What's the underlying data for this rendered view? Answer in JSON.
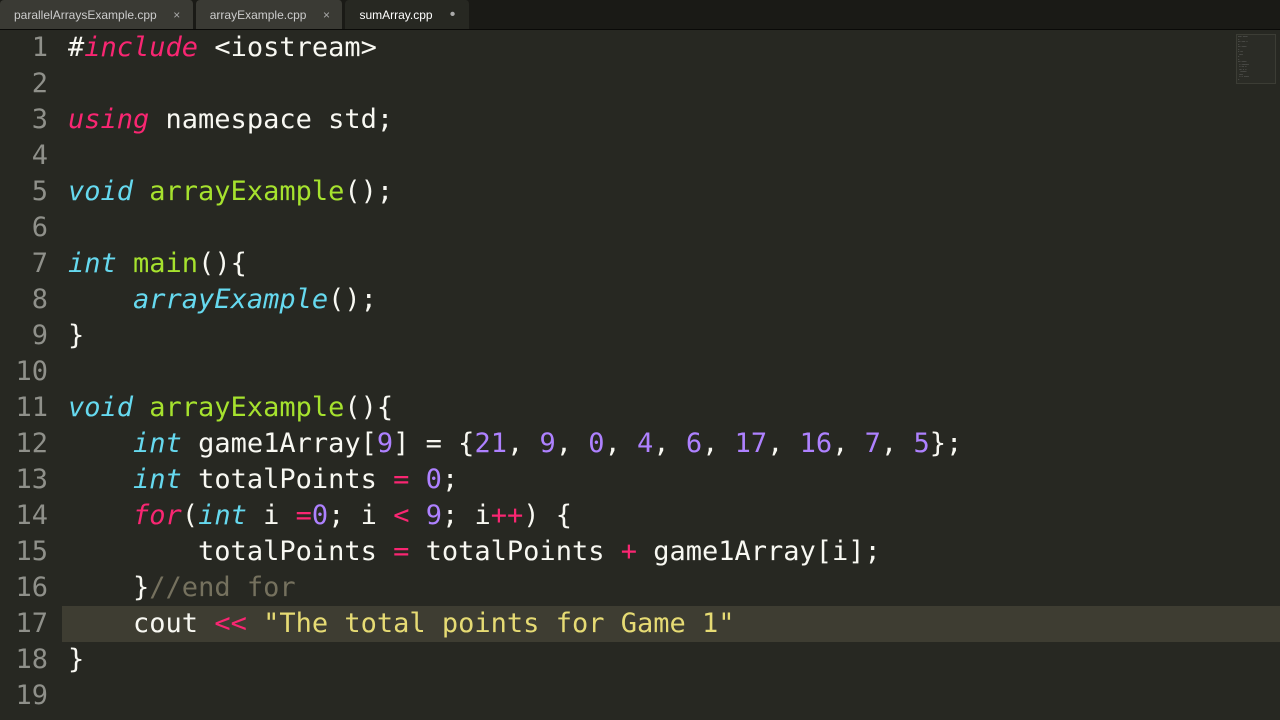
{
  "tabs": [
    {
      "label": "parallelArraysExample.cpp",
      "modified": false
    },
    {
      "label": "arrayExample.cpp",
      "modified": false
    },
    {
      "label": "sumArray.cpp",
      "modified": true
    }
  ],
  "active_tab": 2,
  "line_numbers": [
    "1",
    "2",
    "3",
    "4",
    "5",
    "6",
    "7",
    "8",
    "9",
    "10",
    "11",
    "12",
    "13",
    "14",
    "15",
    "16",
    "17",
    "18",
    "19"
  ],
  "highlighted_line": 17,
  "code": {
    "l1": {
      "hash": "#",
      "include": "include",
      "rest": " <iostream>"
    },
    "l3": {
      "using": "using",
      "ns": " namespace",
      "std": " std",
      "semi": ";"
    },
    "l5": {
      "void": "void ",
      "fn": "arrayExample",
      "rest": "();"
    },
    "l7": {
      "int": "int ",
      "fn": "main",
      "rest": "(){"
    },
    "l8": {
      "indent": "    ",
      "fn": "arrayExample",
      "rest": "();"
    },
    "l9": {
      "brace": "}"
    },
    "l11": {
      "void": "void ",
      "fn": "arrayExample",
      "rest": "(){"
    },
    "l12": {
      "indent": "    ",
      "int": "int",
      "name": " game1Array[",
      "size": "9",
      "mid": "] = {",
      "v0": "21",
      "c0": ", ",
      "v1": "9",
      "c1": ", ",
      "v2": "0",
      "c2": ", ",
      "v3": "4",
      "c3": ", ",
      "v4": "6",
      "c4": ", ",
      "v5": "17",
      "c5": ", ",
      "v6": "16",
      "c6": ", ",
      "v7": "7",
      "c7": ", ",
      "v8": "5",
      "end": "};"
    },
    "l13": {
      "indent": "    ",
      "int": "int",
      "name": " totalPoints ",
      "eq": "=",
      "sp": " ",
      "zero": "0",
      "semi": ";"
    },
    "l14": {
      "indent": "    ",
      "for": "for",
      "p1": "(",
      "int": "int",
      "rest1": " i ",
      "eq": "=",
      "zero": "0",
      "semi1": "; i ",
      "lt": "<",
      "sp": " ",
      "nine": "9",
      "rest2": "; i",
      "pp": "++",
      "rest3": ") {"
    },
    "l15": {
      "indent": "        ",
      "txt1": "totalPoints ",
      "eq": "=",
      "txt2": " totalPoints ",
      "plus": "+",
      "txt3": " game1Array[i];"
    },
    "l16": {
      "indent": "    ",
      "brace": "}",
      "comment": "//end for"
    },
    "l17": {
      "indent": "    ",
      "cout": "cout ",
      "op": "<<",
      "sp": " ",
      "str": "\"The total points for Game 1\""
    },
    "l18": {
      "brace": "}"
    }
  }
}
